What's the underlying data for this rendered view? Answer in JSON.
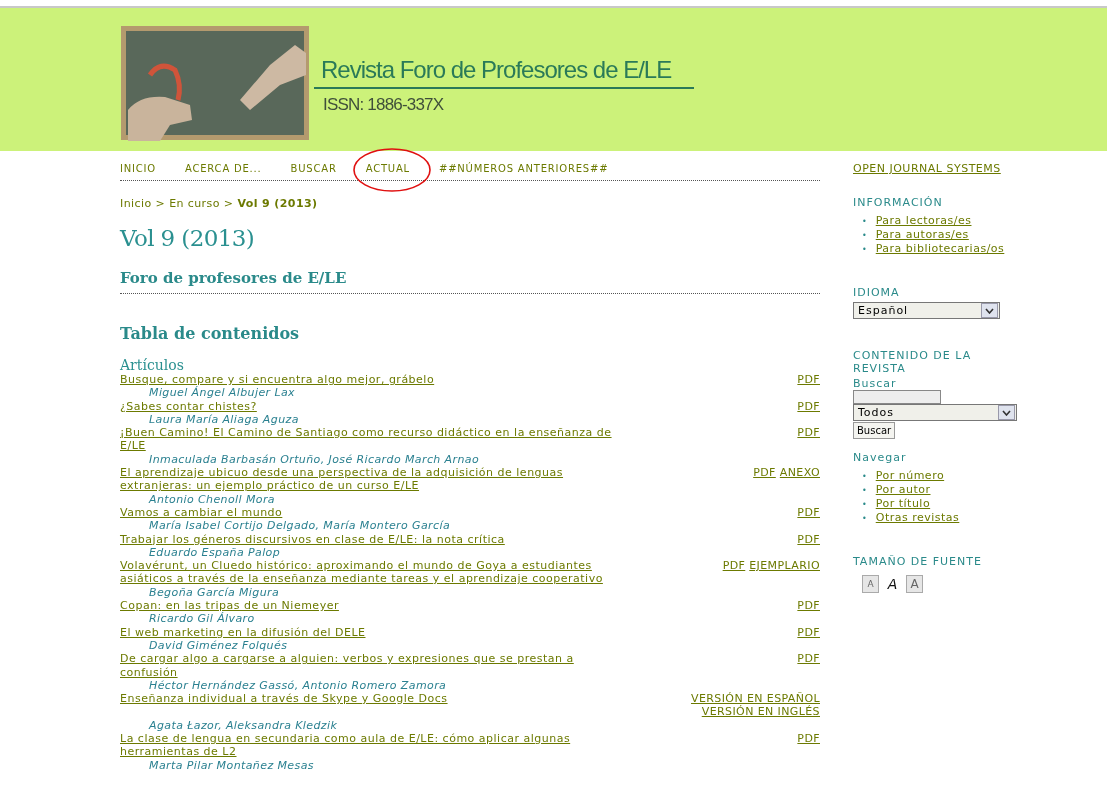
{
  "header": {
    "title": "Revista Foro de Profesores de E/LE",
    "issn": "ISSN: 1886-337X"
  },
  "nav": [
    {
      "label": "INICIO",
      "circled": false
    },
    {
      "label": "ACERCA DE...",
      "circled": false
    },
    {
      "label": "BUSCAR",
      "circled": false
    },
    {
      "label": "ACTUAL",
      "circled": true
    },
    {
      "label": "##NÚMEROS ANTERIORES##",
      "circled": false
    }
  ],
  "breadcrumb": [
    {
      "label": "Inicio",
      "current": false
    },
    {
      "label": "En curso",
      "current": false
    },
    {
      "label": "Vol 9 (2013)",
      "current": true
    }
  ],
  "breadcrumb_separator": ">",
  "page_title": "Vol 9 (2013)",
  "issue_title": "Foro de profesores de E/LE",
  "toc_heading": "Tabla de contenidos",
  "section_heading": "Artículos",
  "articles": [
    {
      "title": "Busque, compare y si encuentra algo mejor, grábelo",
      "authors": "Miguel Ángel Albujer Lax",
      "links": [
        "PDF"
      ]
    },
    {
      "title": "¿Sabes contar chistes?",
      "authors": "Laura María Aliaga Aguza",
      "links": [
        "PDF"
      ]
    },
    {
      "title": "¡Buen Camino! El Camino de Santiago como recurso didáctico en la enseñanza de E/LE",
      "authors": "Inmaculada Barbasán Ortuño, José Ricardo March Arnao",
      "links": [
        "PDF"
      ]
    },
    {
      "title": "El aprendizaje ubicuo desde una perspectiva de la adquisición de lenguas extranjeras: un ejemplo práctico de un curso E/LE",
      "authors": "Antonio Chenoll Mora",
      "links": [
        "PDF",
        "ANEXO"
      ]
    },
    {
      "title": "Vamos a cambiar el mundo",
      "authors": "María Isabel Cortijo Delgado, María Montero García",
      "links": [
        "PDF"
      ]
    },
    {
      "title": "Trabajar los géneros discursivos en clase de E/LE: la nota crítica",
      "authors": "Eduardo España Palop",
      "links": [
        "PDF"
      ]
    },
    {
      "title": "Volavérunt, un Cluedo histórico: aproximando el mundo de Goya a estudiantes asiáticos a través de la enseñanza mediante tareas y el aprendizaje cooperativo",
      "authors": "Begoña García Migura",
      "links": [
        "PDF",
        "EJEMPLARIO"
      ]
    },
    {
      "title": "Copan: en las tripas de un Niemeyer",
      "authors": "Ricardo Gil Álvaro",
      "links": [
        "PDF"
      ]
    },
    {
      "title": "El web marketing en la difusión del DELE",
      "authors": "David Giménez Folqués",
      "links": [
        "PDF"
      ]
    },
    {
      "title": "De cargar algo a cargarse a alguien: verbos y expresiones que se prestan a confusión",
      "authors": "Héctor Hernández Gassó, Antonio Romero Zamora",
      "links": [
        "PDF"
      ]
    },
    {
      "title": "Enseñanza individual a través de Skype y Google Docs",
      "authors": "Agata Łazor, Aleksandra Kledzik",
      "links": [
        "VERSIÓN EN ESPAÑOL",
        "VERSIÓN EN INGLÉS"
      ]
    },
    {
      "title": "La clase de lengua en secundaria como aula de E/LE: cómo aplicar algunas herramientas de L2",
      "authors": "Marta Pilar Montañez Mesas",
      "links": [
        "PDF"
      ]
    }
  ],
  "sidebar": {
    "bullet": "•",
    "ojs_link": "OPEN JOURNAL SYSTEMS",
    "information": {
      "heading": "INFORMACIÓN",
      "items": [
        "Para lectoras/es",
        "Para autoras/es",
        "Para bibliotecarias/os"
      ]
    },
    "language": {
      "heading": "IDIOMA",
      "value": "Español"
    },
    "journal_content": {
      "heading": "CONTENIDO DE LA REVISTA",
      "search_label": "Buscar",
      "scope": "Todos",
      "button": "Buscar",
      "browse_heading": "Navegar",
      "browse_items": [
        "Por número",
        "Por autor",
        "Por título",
        "Otras revistas"
      ]
    },
    "font_size": {
      "heading": "TAMAÑO DE FUENTE",
      "buttons": [
        {
          "kind": "smaller",
          "label": "A"
        },
        {
          "kind": "default",
          "label": "A"
        },
        {
          "kind": "larger",
          "label": "A"
        }
      ]
    }
  }
}
